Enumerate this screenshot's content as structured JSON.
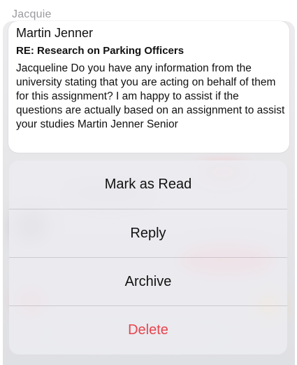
{
  "account": {
    "label": "Jacquie"
  },
  "message": {
    "sender": "Martin Jenner",
    "subject": "RE: Research on Parking Officers",
    "body": "Jacqueline Do you have any information from the university stating that you are acting on behalf of them for this assignment? I am happy to assist if the questions are actually based on an assignment to assist your studies Martin Jenner Senior"
  },
  "actions": {
    "mark_read": "Mark as Read",
    "reply": "Reply",
    "archive": "Archive",
    "delete": "Delete"
  },
  "colors": {
    "destructive": "#e8444d",
    "muted_text": "#9a9a9f",
    "sheet_background": "#ececf0"
  }
}
